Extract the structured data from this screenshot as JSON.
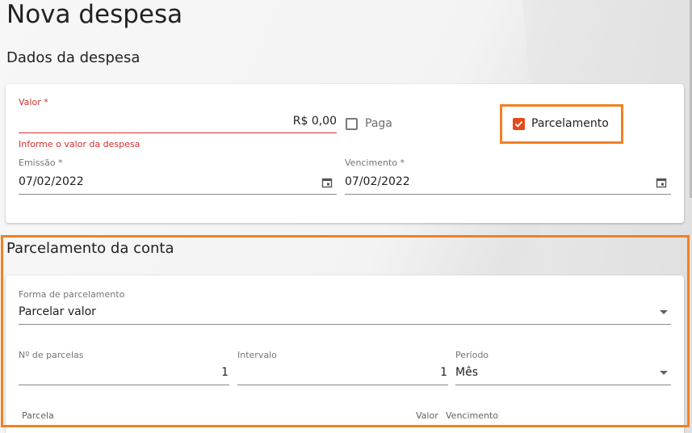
{
  "page": {
    "title": "Nova despesa"
  },
  "expense": {
    "section_title": "Dados da despesa",
    "valor": {
      "label": "Valor *",
      "value": "R$ 0,00",
      "error": "Informe o valor da despesa"
    },
    "paga": {
      "label": "Paga",
      "checked": false
    },
    "parcelamento": {
      "label": "Parcelamento",
      "checked": true
    },
    "emissao": {
      "label": "Emissão *",
      "value": "07/02/2022"
    },
    "vencimento": {
      "label": "Vencimento *",
      "value": "07/02/2022"
    }
  },
  "installments": {
    "section_title": "Parcelamento da conta",
    "forma": {
      "label": "Forma de parcelamento",
      "value": "Parcelar valor"
    },
    "num_parcelas": {
      "label": "Nº de parcelas",
      "value": "1"
    },
    "intervalo": {
      "label": "Intervalo",
      "value": "1"
    },
    "periodo": {
      "label": "Período",
      "value": "Mês"
    },
    "table_headers": {
      "parcela": "Parcela",
      "valor": "Valor",
      "vencimento": "Vencimento"
    }
  },
  "colors": {
    "accent": "#e64a19",
    "highlight": "#f28022",
    "error": "#d32f2f"
  },
  "icons": {
    "calendar": "calendar-icon",
    "dropdown": "chevron-down-icon",
    "check": "check-icon"
  }
}
